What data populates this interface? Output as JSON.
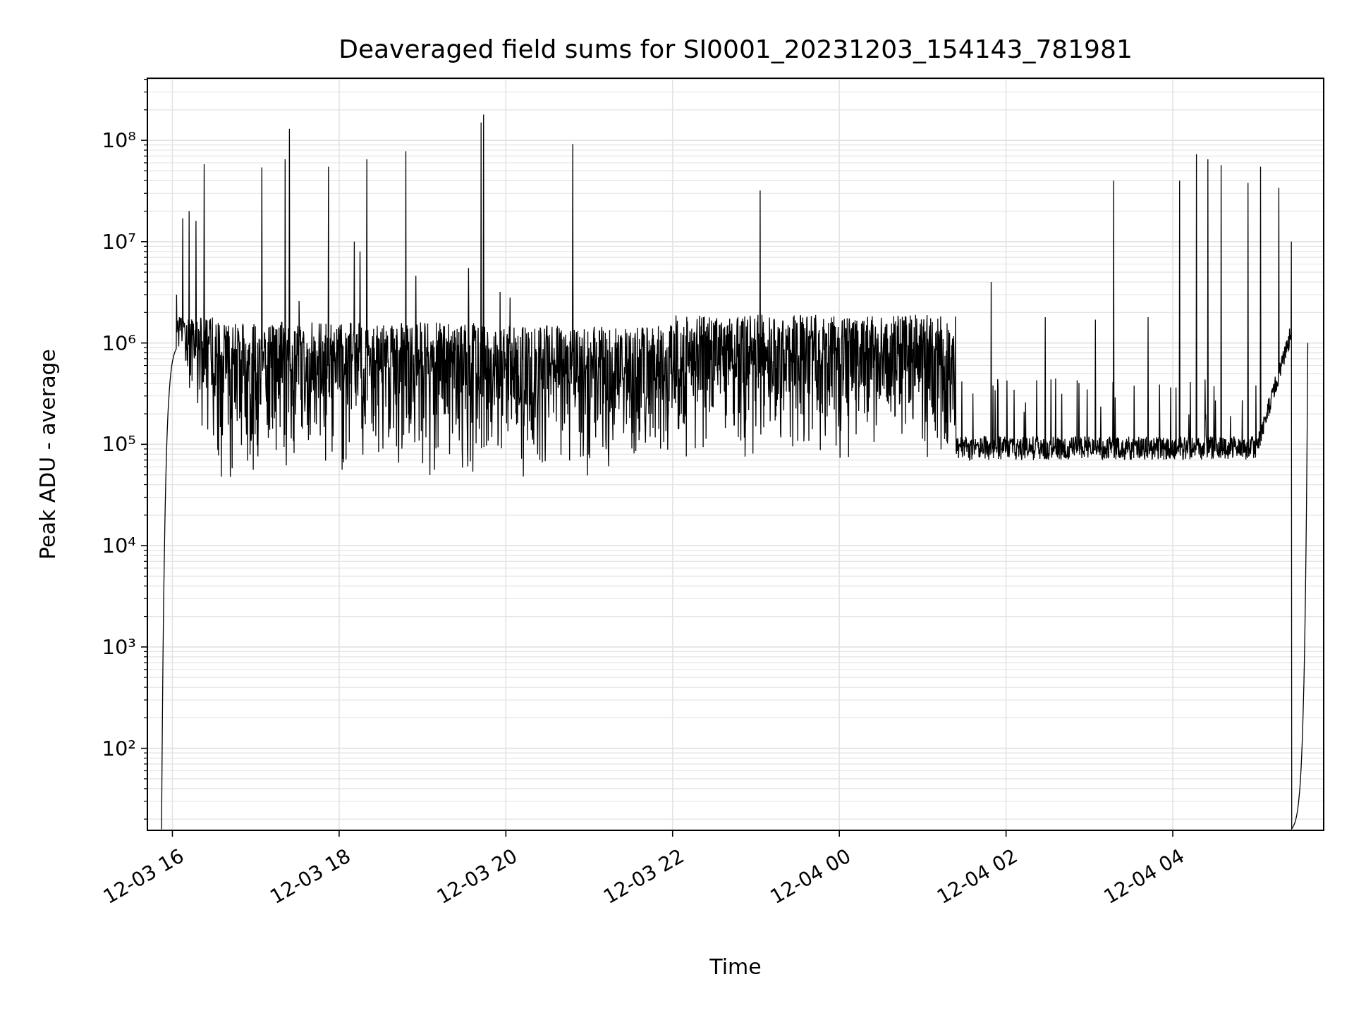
{
  "plot": {
    "title": "Deaveraged field sums for SI0001_20231203_154143_781981",
    "ylabel": "Peak ADU - average",
    "xlabel": "Time",
    "y_tick_labels": [
      "10⁸",
      "10⁷",
      "10⁶",
      "10⁵",
      "10⁴",
      "10³",
      "10²"
    ],
    "x_tick_labels": [
      "12-03 16",
      "12-03 18",
      "12-03 20",
      "12-03 22",
      "12-04 00",
      "12-04 02",
      "12-04 04"
    ]
  }
}
